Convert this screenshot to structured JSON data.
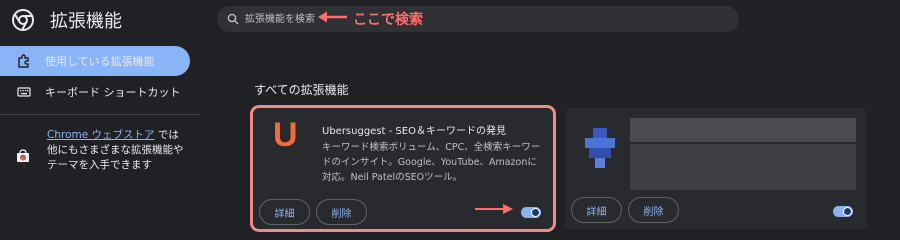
{
  "header": {
    "title": "拡張機能",
    "search_placeholder": "拡張機能を検索",
    "annotation": "ここで検索"
  },
  "sidebar": {
    "items": [
      {
        "label": "使用している拡張機能",
        "icon": "puzzle-icon",
        "active": true
      },
      {
        "label": "キーボード ショートカット",
        "icon": "keyboard-icon",
        "active": false
      }
    ],
    "store": {
      "link": "Chrome ウェブストア",
      "text": " では他にもさまざまな拡張機能やテーマを入手できます"
    }
  },
  "main": {
    "section_title": "すべての拡張機能",
    "cards": [
      {
        "logo": "U",
        "name": "Ubersuggest - SEO＆キーワードの発見",
        "description": "キーワード検索ボリューム、CPC、全検索キーワードのインサイト。Google、YouTube、Amazonに対応。Neil PatelのSEOツール。",
        "details_label": "詳細",
        "remove_label": "削除",
        "enabled": true
      },
      {
        "logo": "",
        "name": "",
        "description": "",
        "details_label": "詳細",
        "remove_label": "削除",
        "enabled": true
      }
    ]
  },
  "colors": {
    "background": "#202124",
    "card": "#292a2d",
    "accent": "#8ab4f8",
    "annotation": "#ff6e6e",
    "logo": "#f86a3a"
  }
}
